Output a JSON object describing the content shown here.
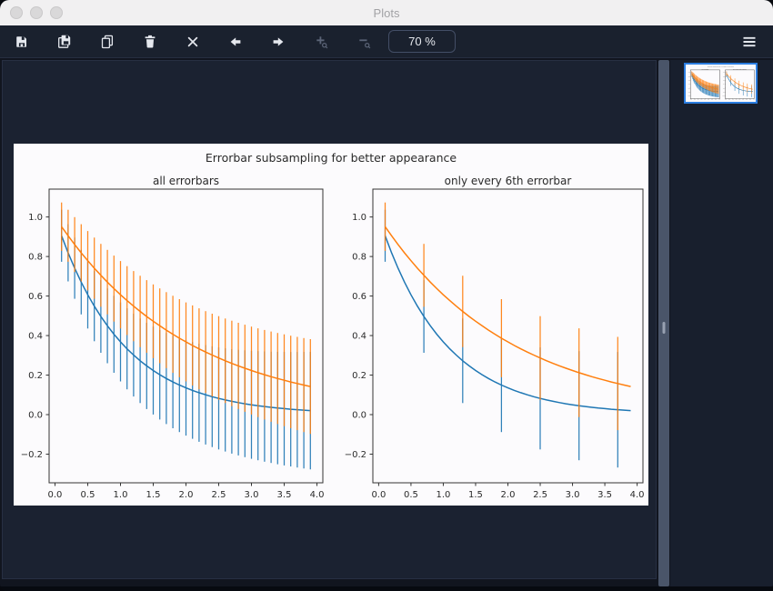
{
  "window": {
    "title": "Plots"
  },
  "toolbar": {
    "zoom_level": "70 %",
    "buttons": [
      {
        "name": "save",
        "icon": "save-icon",
        "enabled": true
      },
      {
        "name": "save-all",
        "icon": "save-all-icon",
        "enabled": true
      },
      {
        "name": "copy",
        "icon": "copy-icon",
        "enabled": true
      },
      {
        "name": "delete",
        "icon": "trash-icon",
        "enabled": true
      },
      {
        "name": "delete-all",
        "icon": "clear-all-icon",
        "enabled": true
      },
      {
        "name": "previous-plot",
        "icon": "arrow-left-icon",
        "enabled": true
      },
      {
        "name": "next-plot",
        "icon": "arrow-right-icon",
        "enabled": true
      },
      {
        "name": "zoom-in",
        "icon": "zoom-in-icon",
        "enabled": false
      },
      {
        "name": "zoom-out",
        "icon": "zoom-out-icon",
        "enabled": false
      },
      {
        "name": "menu",
        "icon": "menu-icon",
        "enabled": true
      }
    ]
  },
  "sidebar": {
    "thumbnail_selected": true
  },
  "chart_data": {
    "type": "line",
    "suptitle": "Errorbar subsampling for better appearance",
    "text_color": "#2a2a2a",
    "spine_color": "#333333",
    "xlim": [
      -0.09,
      4.09
    ],
    "ylim": [
      -0.345,
      1.141
    ],
    "xticks": [
      0.0,
      0.5,
      1.0,
      1.5,
      2.0,
      2.5,
      3.0,
      3.5,
      4.0
    ],
    "xtick_labels": [
      "0.0",
      "0.5",
      "1.0",
      "1.5",
      "2.0",
      "2.5",
      "3.0",
      "3.5",
      "4.0"
    ],
    "yticks": [
      -0.2,
      0.0,
      0.2,
      0.4,
      0.6,
      0.8,
      1.0
    ],
    "ytick_labels": [
      "−0.2",
      "0.0",
      "0.2",
      "0.4",
      "0.6",
      "0.8",
      "1.0"
    ],
    "grid": false,
    "legend": "none",
    "x": [
      0.1,
      0.2,
      0.3,
      0.4,
      0.5,
      0.6,
      0.7,
      0.8,
      0.9,
      1.0,
      1.1,
      1.2,
      1.3,
      1.4,
      1.5,
      1.6,
      1.7,
      1.8,
      1.9,
      2.0,
      2.1,
      2.2,
      2.3,
      2.4,
      2.5,
      2.6,
      2.7,
      2.8,
      2.9,
      3.0,
      3.1,
      3.2,
      3.3,
      3.4,
      3.5,
      3.6,
      3.7,
      3.8,
      3.9
    ],
    "series": [
      {
        "name": "series-blue",
        "color": "#1f77b4",
        "values": [
          0.9048,
          0.8187,
          0.7408,
          0.6703,
          0.6065,
          0.5488,
          0.4966,
          0.4493,
          0.4066,
          0.3679,
          0.3329,
          0.3012,
          0.2725,
          0.2466,
          0.2231,
          0.2019,
          0.1827,
          0.1653,
          0.1496,
          0.1353,
          0.1225,
          0.1108,
          0.1003,
          0.0907,
          0.0821,
          0.0743,
          0.0672,
          0.0608,
          0.055,
          0.0498,
          0.045,
          0.0408,
          0.0369,
          0.0334,
          0.0302,
          0.0273,
          0.0247,
          0.0224,
          0.0202
        ],
        "err": [
          0.1316,
          0.1447,
          0.1548,
          0.1632,
          0.1707,
          0.1775,
          0.1837,
          0.1894,
          0.1949,
          0.2,
          0.2049,
          0.2095,
          0.214,
          0.2183,
          0.2225,
          0.2265,
          0.2304,
          0.2342,
          0.2378,
          0.2414,
          0.2449,
          0.2483,
          0.2517,
          0.2549,
          0.2581,
          0.2612,
          0.2643,
          0.2673,
          0.2703,
          0.2732,
          0.2761,
          0.2789,
          0.2817,
          0.2844,
          0.2871,
          0.2897,
          0.2924,
          0.2949,
          0.2975
        ]
      },
      {
        "name": "series-orange",
        "color": "#ff7f0e",
        "values": [
          0.9512,
          0.9048,
          0.8607,
          0.8187,
          0.7788,
          0.7408,
          0.7047,
          0.6703,
          0.6376,
          0.6065,
          0.5769,
          0.5488,
          0.522,
          0.4966,
          0.4724,
          0.4493,
          0.4274,
          0.4066,
          0.3867,
          0.3679,
          0.3499,
          0.3329,
          0.3166,
          0.3012,
          0.2865,
          0.2725,
          0.2592,
          0.2466,
          0.2346,
          0.2231,
          0.2122,
          0.2019,
          0.192,
          0.1827,
          0.1738,
          0.1653,
          0.1572,
          0.1496,
          0.1423
        ],
        "err": [
          0.1224,
          0.1316,
          0.1387,
          0.1447,
          0.15,
          0.1548,
          0.1592,
          0.1632,
          0.1671,
          0.1707,
          0.1742,
          0.1775,
          0.1806,
          0.1837,
          0.1866,
          0.1894,
          0.1922,
          0.1949,
          0.1975,
          0.2,
          0.2025,
          0.2049,
          0.2072,
          0.2095,
          0.2118,
          0.214,
          0.2162,
          0.2183,
          0.2204,
          0.2225,
          0.2245,
          0.2265,
          0.2285,
          0.2304,
          0.2323,
          0.2342,
          0.236,
          0.2378,
          0.2396
        ]
      }
    ],
    "subplots": [
      {
        "title": "all errorbars",
        "errorevery": 1
      },
      {
        "title": "only every 6th errorbar",
        "errorevery": 6
      }
    ]
  }
}
